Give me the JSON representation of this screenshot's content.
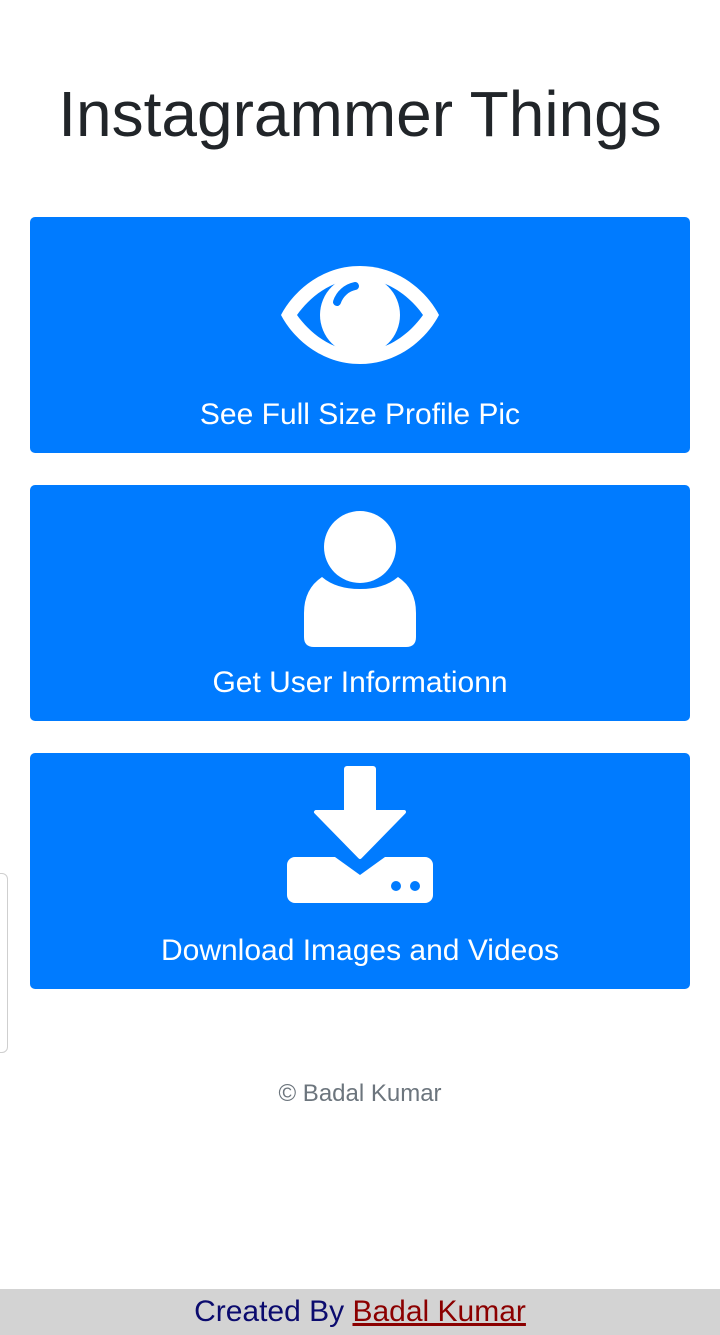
{
  "page": {
    "title": "Instagrammer Things"
  },
  "cards": [
    {
      "label": "See Full Size Profile Pic",
      "icon": "eye-icon"
    },
    {
      "label": "Get User Informationn",
      "icon": "user-icon"
    },
    {
      "label": "Download Images and Videos",
      "icon": "download-icon"
    }
  ],
  "copyright": "© Badal Kumar",
  "footer": {
    "prefix": "Created By ",
    "link_text": "Badal Kumar"
  },
  "colors": {
    "card_blue": "#007bff",
    "footer_bar": "#d3d3d3",
    "footer_prefix": "#0b0b6e",
    "footer_link": "#8b0000"
  }
}
